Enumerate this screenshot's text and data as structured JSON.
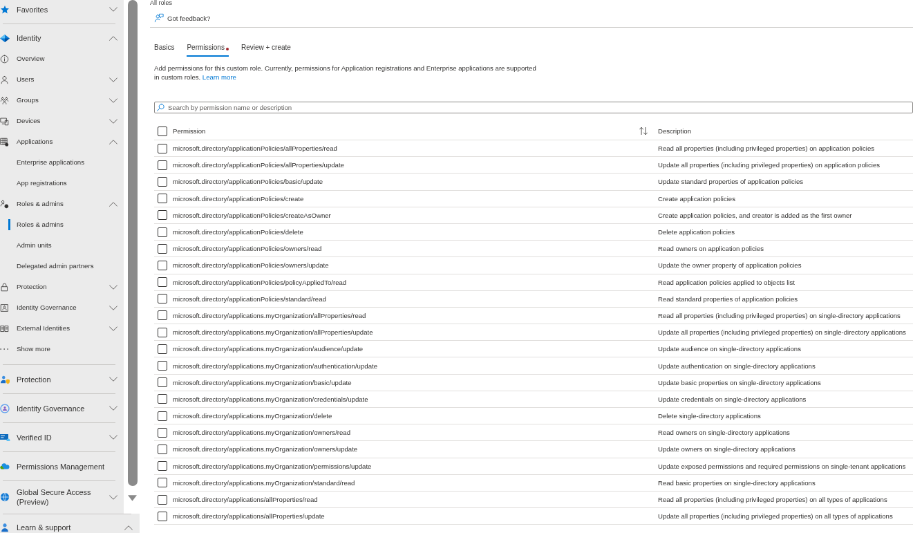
{
  "sidebar": {
    "sections": [
      {
        "label": "Favorites",
        "kind": "group",
        "expanded": false
      },
      {
        "label": "Identity",
        "kind": "group",
        "expanded": true,
        "children": [
          {
            "label": "Overview",
            "kind": "link",
            "selected": false
          },
          {
            "label": "Users",
            "kind": "group",
            "expanded": false,
            "selected": false
          },
          {
            "label": "Groups",
            "kind": "group",
            "expanded": false,
            "selected": false
          },
          {
            "label": "Devices",
            "kind": "group",
            "expanded": false,
            "selected": false
          },
          {
            "label": "Applications",
            "kind": "group",
            "expanded": true,
            "selected": false,
            "children": [
              {
                "label": "Enterprise applications",
                "selected": false
              },
              {
                "label": "App registrations",
                "selected": false
              }
            ]
          },
          {
            "label": "Roles & admins",
            "kind": "group",
            "expanded": true,
            "selected": false,
            "children": [
              {
                "label": "Roles & admins",
                "selected": true
              },
              {
                "label": "Admin units",
                "selected": false
              },
              {
                "label": "Delegated admin partners",
                "selected": false
              }
            ]
          },
          {
            "label": "Protection",
            "kind": "group",
            "expanded": false,
            "selected": false
          },
          {
            "label": "Identity Governance",
            "kind": "group",
            "expanded": false,
            "selected": false
          },
          {
            "label": "External Identities",
            "kind": "group",
            "expanded": false,
            "selected": false
          },
          {
            "label": "Show more",
            "kind": "link",
            "selected": false
          }
        ]
      },
      {
        "label": "Protection",
        "kind": "group",
        "expanded": false
      },
      {
        "label": "Identity Governance",
        "kind": "group",
        "expanded": false
      },
      {
        "label": "Verified ID",
        "kind": "group",
        "expanded": false
      },
      {
        "label": "Permissions Management",
        "kind": "link"
      },
      {
        "label": "Global Secure Access (Preview)",
        "kind": "group",
        "expanded": false
      }
    ],
    "footer": {
      "label": "Learn & support",
      "expanded": true
    }
  },
  "breadcrumb": "All roles",
  "feedback": "Got feedback?",
  "tabs": [
    {
      "label": "Basics",
      "selected": false,
      "has_error": false
    },
    {
      "label": "Permissions",
      "selected": true,
      "has_error": true
    },
    {
      "label": "Review + create",
      "selected": false,
      "has_error": false
    }
  ],
  "intro": {
    "text": "Add permissions for this custom role. Currently, permissions for Application registrations and Enterprise applications are supported in custom roles.",
    "link": "Learn more"
  },
  "search": {
    "placeholder": "Search by permission name or description"
  },
  "table": {
    "select_all": {
      "checked": false
    },
    "columns": [
      {
        "label": "Permission"
      },
      {
        "label": "Description"
      }
    ],
    "rows": [
      {
        "checked": false,
        "permission": "microsoft.directory/applicationPolicies/allProperties/read",
        "description": "Read all properties (including privileged properties) on application policies"
      },
      {
        "checked": false,
        "permission": "microsoft.directory/applicationPolicies/allProperties/update",
        "description": "Update all properties (including privileged properties) on application policies"
      },
      {
        "checked": false,
        "permission": "microsoft.directory/applicationPolicies/basic/update",
        "description": "Update standard properties of application policies"
      },
      {
        "checked": false,
        "permission": "microsoft.directory/applicationPolicies/create",
        "description": "Create application policies"
      },
      {
        "checked": false,
        "permission": "microsoft.directory/applicationPolicies/createAsOwner",
        "description": "Create application policies, and creator is added as the first owner"
      },
      {
        "checked": false,
        "permission": "microsoft.directory/applicationPolicies/delete",
        "description": "Delete application policies"
      },
      {
        "checked": false,
        "permission": "microsoft.directory/applicationPolicies/owners/read",
        "description": "Read owners on application policies"
      },
      {
        "checked": false,
        "permission": "microsoft.directory/applicationPolicies/owners/update",
        "description": "Update the owner property of application policies"
      },
      {
        "checked": false,
        "permission": "microsoft.directory/applicationPolicies/policyAppliedTo/read",
        "description": "Read application policies applied to objects list"
      },
      {
        "checked": false,
        "permission": "microsoft.directory/applicationPolicies/standard/read",
        "description": "Read standard properties of application policies"
      },
      {
        "checked": false,
        "permission": "microsoft.directory/applications.myOrganization/allProperties/read",
        "description": "Read all properties (including privileged properties) on single-directory applications"
      },
      {
        "checked": false,
        "permission": "microsoft.directory/applications.myOrganization/allProperties/update",
        "description": "Update all properties (including privileged properties) on single-directory applications"
      },
      {
        "checked": false,
        "permission": "microsoft.directory/applications.myOrganization/audience/update",
        "description": "Update audience on single-directory applications"
      },
      {
        "checked": false,
        "permission": "microsoft.directory/applications.myOrganization/authentication/update",
        "description": "Update authentication on single-directory applications"
      },
      {
        "checked": false,
        "permission": "microsoft.directory/applications.myOrganization/basic/update",
        "description": "Update basic properties on single-directory applications"
      },
      {
        "checked": false,
        "permission": "microsoft.directory/applications.myOrganization/credentials/update",
        "description": "Update credentials on single-directory applications"
      },
      {
        "checked": false,
        "permission": "microsoft.directory/applications.myOrganization/delete",
        "description": "Delete single-directory applications"
      },
      {
        "checked": false,
        "permission": "microsoft.directory/applications.myOrganization/owners/read",
        "description": "Read owners on single-directory applications"
      },
      {
        "checked": false,
        "permission": "microsoft.directory/applications.myOrganization/owners/update",
        "description": "Update owners on single-directory applications"
      },
      {
        "checked": false,
        "permission": "microsoft.directory/applications.myOrganization/permissions/update",
        "description": "Update exposed permissions and required permissions on single-tenant applications"
      },
      {
        "checked": false,
        "permission": "microsoft.directory/applications.myOrganization/standard/read",
        "description": "Read basic properties on single-directory applications"
      },
      {
        "checked": false,
        "permission": "microsoft.directory/applications/allProperties/read",
        "description": "Read all properties (including privileged properties) on all types of applications"
      },
      {
        "checked": false,
        "permission": "microsoft.directory/applications/allProperties/update",
        "description": "Update all properties (including privileged properties) on all types of applications"
      }
    ]
  }
}
